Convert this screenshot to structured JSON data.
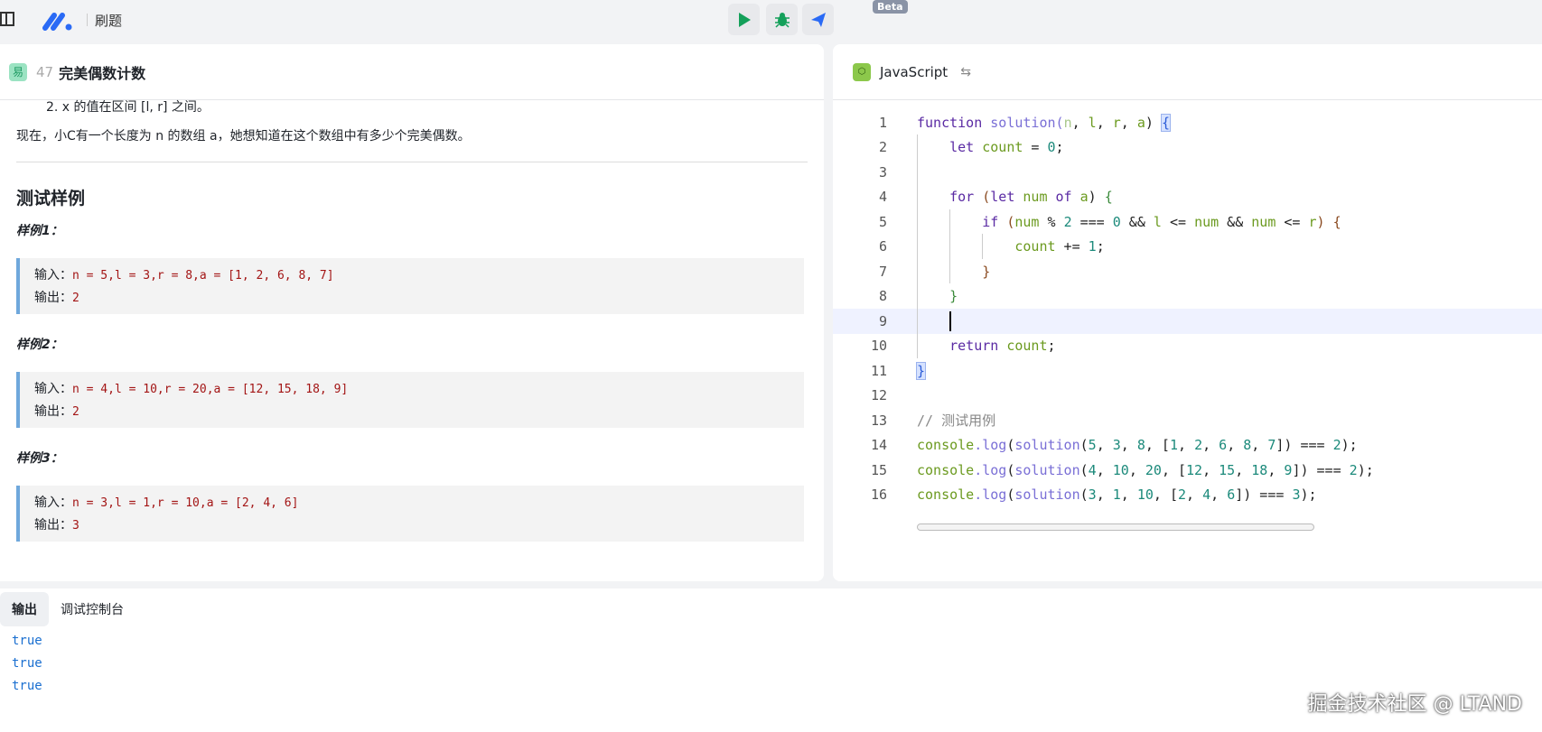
{
  "app": {
    "title": "刷题",
    "beta": "Beta"
  },
  "problem": {
    "difficulty": "易",
    "number": "47",
    "title": "完美偶数计数",
    "cond2": "2. x 的值在区间 [l, r] 之间。",
    "desc": "现在，小C有一个长度为 n 的数组 a，她想知道在这个数组中有多少个完美偶数。",
    "tests_heading": "测试样例",
    "examples": [
      {
        "label": "样例1：",
        "in_label": "输入：",
        "input": "n = 5,l = 3,r = 8,a = [1, 2, 6, 8, 7]",
        "out_label": "输出：",
        "output": "2"
      },
      {
        "label": "样例2：",
        "in_label": "输入：",
        "input": "n = 4,l = 10,r = 20,a = [12, 15, 18, 9]",
        "out_label": "输出：",
        "output": "2"
      },
      {
        "label": "样例3：",
        "in_label": "输入：",
        "input": "n = 3,l = 1,r = 10,a = [2, 4, 6]",
        "out_label": "输出：",
        "output": "3"
      }
    ]
  },
  "editor": {
    "language": "JavaScript",
    "current_line": 9,
    "lines": [
      [
        [
          "function",
          "k"
        ],
        [
          " solution",
          "f"
        ],
        [
          "(",
          "f"
        ],
        [
          "n",
          "pd"
        ],
        [
          ", ",
          "o"
        ],
        [
          "l",
          "v"
        ],
        [
          ", ",
          "o"
        ],
        [
          "r",
          "v"
        ],
        [
          ", ",
          "o"
        ],
        [
          "a",
          "v"
        ],
        [
          ")",
          "o"
        ],
        [
          " ",
          "o"
        ],
        [
          "{",
          "bh"
        ]
      ],
      [
        [
          "    let",
          "k"
        ],
        [
          " count",
          "v"
        ],
        [
          " = ",
          "o"
        ],
        [
          "0",
          "n"
        ],
        [
          ";",
          "o"
        ]
      ],
      [],
      [
        [
          "    for",
          "k"
        ],
        [
          " (",
          "b"
        ],
        [
          "let",
          "k"
        ],
        [
          " num",
          "v"
        ],
        [
          " of",
          "k"
        ],
        [
          " a",
          "v"
        ],
        [
          ")",
          "o"
        ],
        [
          " {",
          "g"
        ]
      ],
      [
        [
          "        if",
          "k"
        ],
        [
          " (",
          "b"
        ],
        [
          "num",
          "v"
        ],
        [
          " % ",
          "o"
        ],
        [
          "2",
          "n"
        ],
        [
          " === ",
          "o"
        ],
        [
          "0",
          "n"
        ],
        [
          " && ",
          "o"
        ],
        [
          "l",
          "v"
        ],
        [
          " <= ",
          "o"
        ],
        [
          "num",
          "v"
        ],
        [
          " && ",
          "o"
        ],
        [
          "num",
          "v"
        ],
        [
          " <= ",
          "o"
        ],
        [
          "r",
          "v"
        ],
        [
          ")",
          "b"
        ],
        [
          " {",
          "b"
        ]
      ],
      [
        [
          "            count",
          "v"
        ],
        [
          " += ",
          "o"
        ],
        [
          "1",
          "n"
        ],
        [
          ";",
          "o"
        ]
      ],
      [
        [
          "        }",
          "b"
        ]
      ],
      [
        [
          "    }",
          "g"
        ]
      ],
      [],
      [
        [
          "    return",
          "k"
        ],
        [
          " count",
          "v"
        ],
        [
          ";",
          "o"
        ]
      ],
      [
        [
          "}",
          "bh"
        ]
      ],
      [],
      [
        [
          "// 测试用例",
          "c"
        ]
      ],
      [
        [
          "console",
          "v"
        ],
        [
          ".log",
          "f"
        ],
        [
          "(",
          "o"
        ],
        [
          "solution",
          "f"
        ],
        [
          "(",
          "o"
        ],
        [
          "5",
          "n"
        ],
        [
          ", ",
          "o"
        ],
        [
          "3",
          "n"
        ],
        [
          ", ",
          "o"
        ],
        [
          "8",
          "n"
        ],
        [
          ", [",
          "o"
        ],
        [
          "1",
          "n"
        ],
        [
          ", ",
          "o"
        ],
        [
          "2",
          "n"
        ],
        [
          ", ",
          "o"
        ],
        [
          "6",
          "n"
        ],
        [
          ", ",
          "o"
        ],
        [
          "8",
          "n"
        ],
        [
          ", ",
          "o"
        ],
        [
          "7",
          "n"
        ],
        [
          "]) === ",
          "o"
        ],
        [
          "2",
          "n"
        ],
        [
          ");",
          "o"
        ]
      ],
      [
        [
          "console",
          "v"
        ],
        [
          ".log",
          "f"
        ],
        [
          "(",
          "o"
        ],
        [
          "solution",
          "f"
        ],
        [
          "(",
          "o"
        ],
        [
          "4",
          "n"
        ],
        [
          ", ",
          "o"
        ],
        [
          "10",
          "n"
        ],
        [
          ", ",
          "o"
        ],
        [
          "20",
          "n"
        ],
        [
          ", [",
          "o"
        ],
        [
          "12",
          "n"
        ],
        [
          ", ",
          "o"
        ],
        [
          "15",
          "n"
        ],
        [
          ", ",
          "o"
        ],
        [
          "18",
          "n"
        ],
        [
          ", ",
          "o"
        ],
        [
          "9",
          "n"
        ],
        [
          "]) === ",
          "o"
        ],
        [
          "2",
          "n"
        ],
        [
          ");",
          "o"
        ]
      ],
      [
        [
          "console",
          "v"
        ],
        [
          ".log",
          "f"
        ],
        [
          "(",
          "o"
        ],
        [
          "solution",
          "f"
        ],
        [
          "(",
          "o"
        ],
        [
          "3",
          "n"
        ],
        [
          ", ",
          "o"
        ],
        [
          "1",
          "n"
        ],
        [
          ", ",
          "o"
        ],
        [
          "10",
          "n"
        ],
        [
          ", [",
          "o"
        ],
        [
          "2",
          "n"
        ],
        [
          ", ",
          "o"
        ],
        [
          "4",
          "n"
        ],
        [
          ", ",
          "o"
        ],
        [
          "6",
          "n"
        ],
        [
          "]) === ",
          "o"
        ],
        [
          "3",
          "n"
        ],
        [
          ");",
          "o"
        ]
      ]
    ]
  },
  "console": {
    "tabs": [
      "输出",
      "调试控制台"
    ],
    "output": [
      "true",
      "true",
      "true"
    ]
  },
  "watermark": "掘金技术社区 @ LTAND"
}
